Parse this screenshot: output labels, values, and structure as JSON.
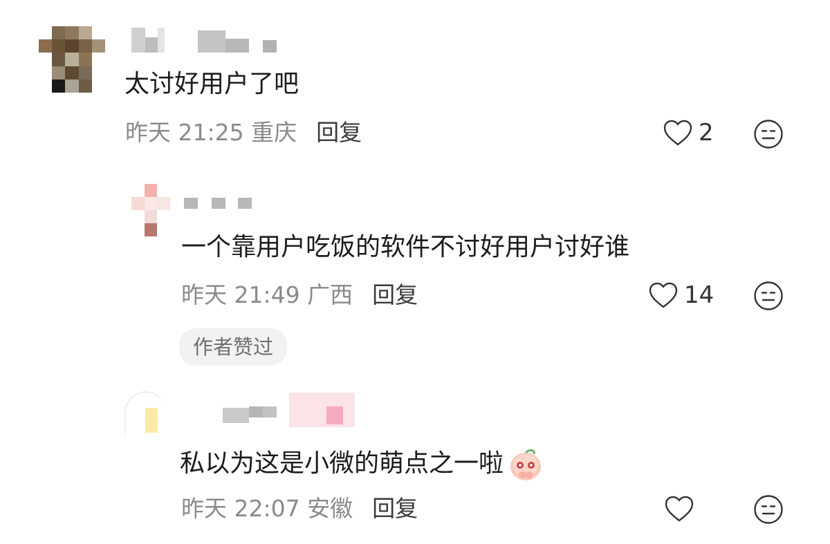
{
  "comments": [
    {
      "text": "太讨好用户了吧",
      "meta": "昨天 21:25 重庆",
      "reply_label": "回复",
      "likes": "2"
    },
    {
      "text": "一个靠用户吃饭的软件不讨好用户讨好谁",
      "meta": "昨天 21:49 广西",
      "reply_label": "回复",
      "likes": "14",
      "badge": "作者赞过"
    },
    {
      "text": "私以为这是小微的萌点之一啦",
      "meta": "昨天 22:07 安徽",
      "reply_label": "回复",
      "likes": ""
    }
  ],
  "icons": {
    "like": "heart-outline-icon",
    "dislike": "neutral-face-icon",
    "emoji": "peach-shy-emoji"
  },
  "colors": {
    "meta_text": "#8a8a8a",
    "reply_text": "#3a3a3a",
    "badge_bg": "#f2f2f2"
  }
}
